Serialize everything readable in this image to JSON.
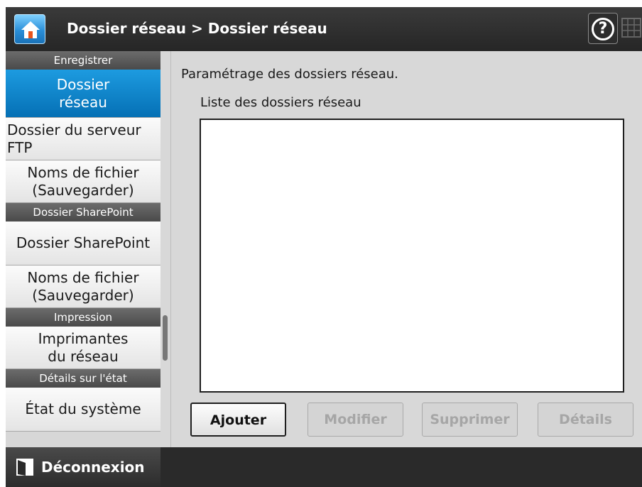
{
  "header": {
    "title": "Dossier réseau > Dossier réseau",
    "help_symbol": "?",
    "icons": [
      "home-icon",
      "help-icon",
      "keyboard-icon"
    ]
  },
  "sidebar": {
    "sections": [
      {
        "header": "Enregistrer",
        "items": [
          {
            "lines": [
              "Dossier",
              "réseau"
            ],
            "active": true
          },
          {
            "lines": [
              "Dossier du serveur",
              "FTP"
            ],
            "active": false
          },
          {
            "lines": [
              "Noms de fichier",
              "(Sauvegarder)"
            ],
            "active": false
          }
        ]
      },
      {
        "header": "Dossier SharePoint",
        "items": [
          {
            "lines": [
              "Dossier SharePoint"
            ],
            "active": false
          },
          {
            "lines": [
              "Noms de fichier",
              "(Sauvegarder)"
            ],
            "active": false
          }
        ]
      },
      {
        "header": "Impression",
        "items": [
          {
            "lines": [
              "Imprimantes",
              "du réseau"
            ],
            "active": false
          }
        ]
      },
      {
        "header": "Détails sur l'état",
        "items": [
          {
            "lines": [
              "État du système"
            ],
            "active": false
          }
        ]
      }
    ]
  },
  "main": {
    "description": "Paramétrage des dossiers réseau.",
    "list_label": "Liste des dossiers réseau",
    "list_items": [],
    "buttons": {
      "add": "Ajouter",
      "modify": "Modifier",
      "delete": "Supprimer",
      "details": "Détails"
    }
  },
  "footer": {
    "logout_label": "Déconnexion"
  },
  "colors": {
    "active_nav": "#0a83cc",
    "header_bg": "#2f2f2f",
    "panel_bg": "#d8d8d8"
  }
}
